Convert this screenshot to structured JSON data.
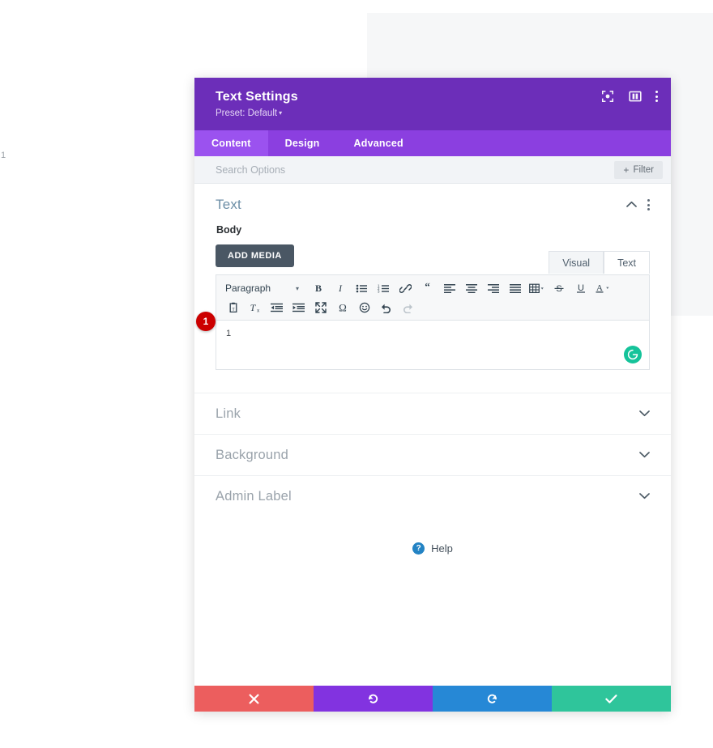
{
  "background": {
    "stray_number": "1"
  },
  "modal": {
    "title": "Text Settings",
    "preset_label": "Preset: Default",
    "preset_caret": "▾",
    "header_icons": [
      {
        "name": "focus-target-icon",
        "label": "Focus"
      },
      {
        "name": "layout-panel-icon",
        "label": "Layout"
      },
      {
        "name": "kebab-menu-icon",
        "label": "More options"
      }
    ],
    "tabs": [
      {
        "label": "Content",
        "active": true
      },
      {
        "label": "Design",
        "active": false
      },
      {
        "label": "Advanced",
        "active": false
      }
    ],
    "search": {
      "placeholder": "Search Options",
      "value": ""
    },
    "filter_button": {
      "plus": "+",
      "label": "Filter"
    }
  },
  "text_section": {
    "title": "Text",
    "field_label": "Body",
    "add_media_label": "ADD MEDIA",
    "editor_tabs": [
      {
        "label": "Visual",
        "active": false
      },
      {
        "label": "Text",
        "active": true
      }
    ],
    "toolbar": {
      "format_select": "Paragraph",
      "format_caret": "▾",
      "row1": [
        "bold-icon",
        "italic-icon",
        "bulleted-list-icon",
        "numbered-list-icon",
        "link-icon",
        "blockquote-icon",
        "align-left-icon",
        "align-center-icon",
        "align-right-icon",
        "align-justify-icon",
        "table-icon",
        "strikethrough-icon",
        "underline-icon",
        "text-color-icon"
      ],
      "row2": [
        "paste-as-text-icon",
        "clear-formatting-icon",
        "outdent-icon",
        "indent-icon",
        "fullscreen-icon",
        "special-character-icon",
        "emoji-icon",
        "undo-icon",
        "redo-icon"
      ]
    },
    "editor_content": "1",
    "grammarly_icon": "grammarly-icon",
    "marker_badge": "1"
  },
  "collapsed_sections": [
    {
      "title": "Link"
    },
    {
      "title": "Background"
    },
    {
      "title": "Admin Label"
    }
  ],
  "help": {
    "icon_glyph": "?",
    "label": "Help"
  },
  "footer_buttons": [
    {
      "name": "cancel-button",
      "icon": "close-icon",
      "color": "#ec5e5e"
    },
    {
      "name": "undo-button",
      "icon": "undo-icon",
      "color": "#8233e0"
    },
    {
      "name": "redo-button",
      "icon": "redo-icon",
      "color": "#2688d6"
    },
    {
      "name": "save-button",
      "icon": "check-icon",
      "color": "#2fc59b"
    }
  ],
  "colors": {
    "header_purple": "#6c2eb9",
    "tabs_purple": "#8b3fe0",
    "active_tab_purple": "#9b52ef",
    "accent_teal": "#15c39a",
    "marker_red": "#cc0000"
  }
}
